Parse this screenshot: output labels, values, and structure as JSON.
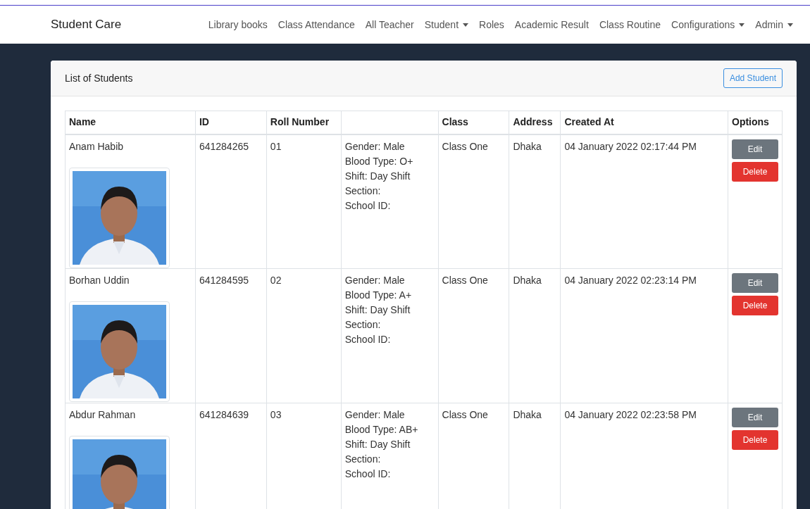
{
  "navbar": {
    "brand": "Student Care",
    "items": [
      {
        "label": "Library books",
        "dropdown": false
      },
      {
        "label": "Class Attendance",
        "dropdown": false
      },
      {
        "label": "All Teacher",
        "dropdown": false
      },
      {
        "label": "Student",
        "dropdown": true
      },
      {
        "label": "Roles",
        "dropdown": false
      },
      {
        "label": "Academic Result",
        "dropdown": false
      },
      {
        "label": "Class Routine",
        "dropdown": false
      },
      {
        "label": "Configurations",
        "dropdown": true
      },
      {
        "label": "Admin",
        "dropdown": true
      }
    ]
  },
  "card": {
    "title": "List of Students",
    "add_button": "Add Student"
  },
  "table": {
    "columns": [
      {
        "kind": "text",
        "label": "Name"
      },
      {
        "kind": "text",
        "label": "ID"
      },
      {
        "kind": "text",
        "label": "Roll Number"
      },
      {
        "kind": "blank"
      },
      {
        "kind": "text",
        "label": "Class"
      },
      {
        "kind": "text",
        "label": "Address"
      },
      {
        "kind": "text",
        "label": "Created At"
      },
      {
        "kind": "text",
        "label": "Options"
      }
    ],
    "rows": [
      {
        "name": "Anam Habib",
        "photo": {
          "kind": "picture"
        },
        "id": "641284265",
        "roll": "01",
        "details": [
          "Gender: Male",
          "Blood Type: O+",
          "Shift: Day Shift",
          "Section:",
          "School ID:"
        ],
        "class": "Class One",
        "address": "Dhaka",
        "created_at": "04 January 2022 02:17:44 PM",
        "actions": [
          {
            "kind": "edit",
            "label": "Edit"
          },
          {
            "kind": "delete",
            "label": "Delete"
          }
        ]
      },
      {
        "name": "Borhan Uddin",
        "photo": {
          "kind": "picture"
        },
        "id": "641284595",
        "roll": "02",
        "details": [
          "Gender: Male",
          "Blood Type: A+",
          "Shift: Day Shift",
          "Section:",
          "School ID:"
        ],
        "class": "Class One",
        "address": "Dhaka",
        "created_at": "04 January 2022 02:23:14 PM",
        "actions": [
          {
            "kind": "edit",
            "label": "Edit"
          },
          {
            "kind": "delete",
            "label": "Delete"
          }
        ]
      },
      {
        "name": "Abdur Rahman",
        "photo": {
          "kind": "picture"
        },
        "id": "641284639",
        "roll": "03",
        "details": [
          "Gender: Male",
          "Blood Type: AB+",
          "Shift: Day Shift",
          "Section:",
          "School ID:"
        ],
        "class": "Class One",
        "address": "Dhaka",
        "created_at": "04 January 2022 02:23:58 PM",
        "actions": [
          {
            "kind": "edit",
            "label": "Edit"
          },
          {
            "kind": "delete",
            "label": "Delete"
          }
        ]
      }
    ]
  }
}
